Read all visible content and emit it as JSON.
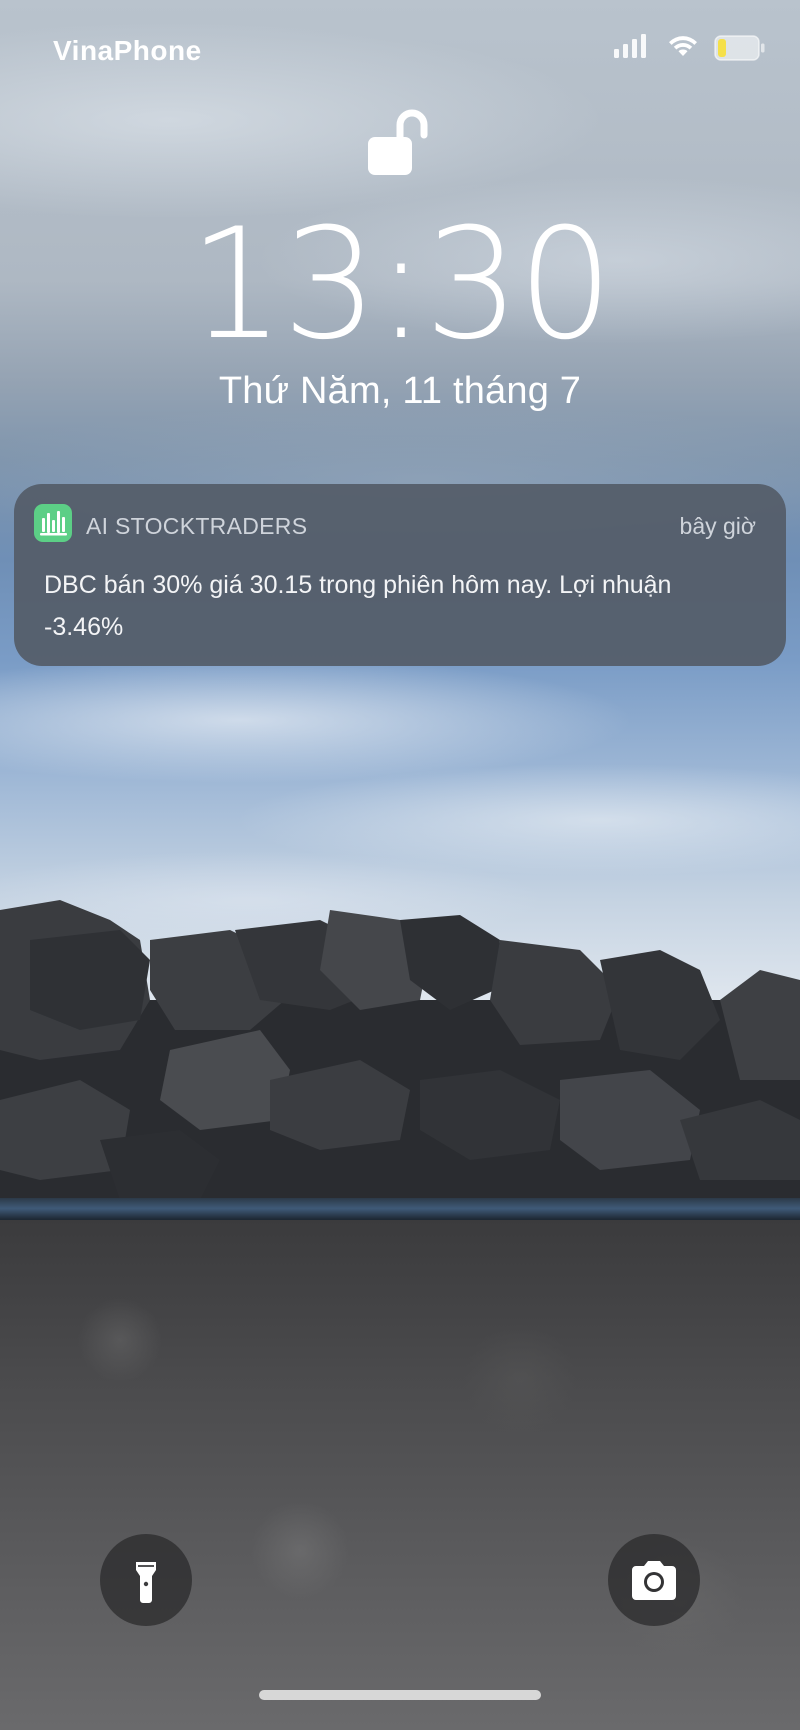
{
  "status_bar": {
    "carrier": "VinaPhone",
    "icons": [
      "cellular-signal-icon",
      "wifi-icon",
      "battery-icon"
    ]
  },
  "lock_screen": {
    "lock_icon": "unlocked-padlock-icon",
    "time": "13:30",
    "date": "Thứ Năm, 11 tháng 7"
  },
  "notification": {
    "app_name": "AI STOCKTRADERS",
    "timestamp": "bây giờ",
    "body": "DBC bán 30% giá 30.15 trong phiên hôm nay. Lợi nhuận -3.46%",
    "app_icon_color": "#5ccf86"
  },
  "controls": {
    "left_button_icon": "flashlight-icon",
    "right_button_icon": "camera-icon"
  }
}
